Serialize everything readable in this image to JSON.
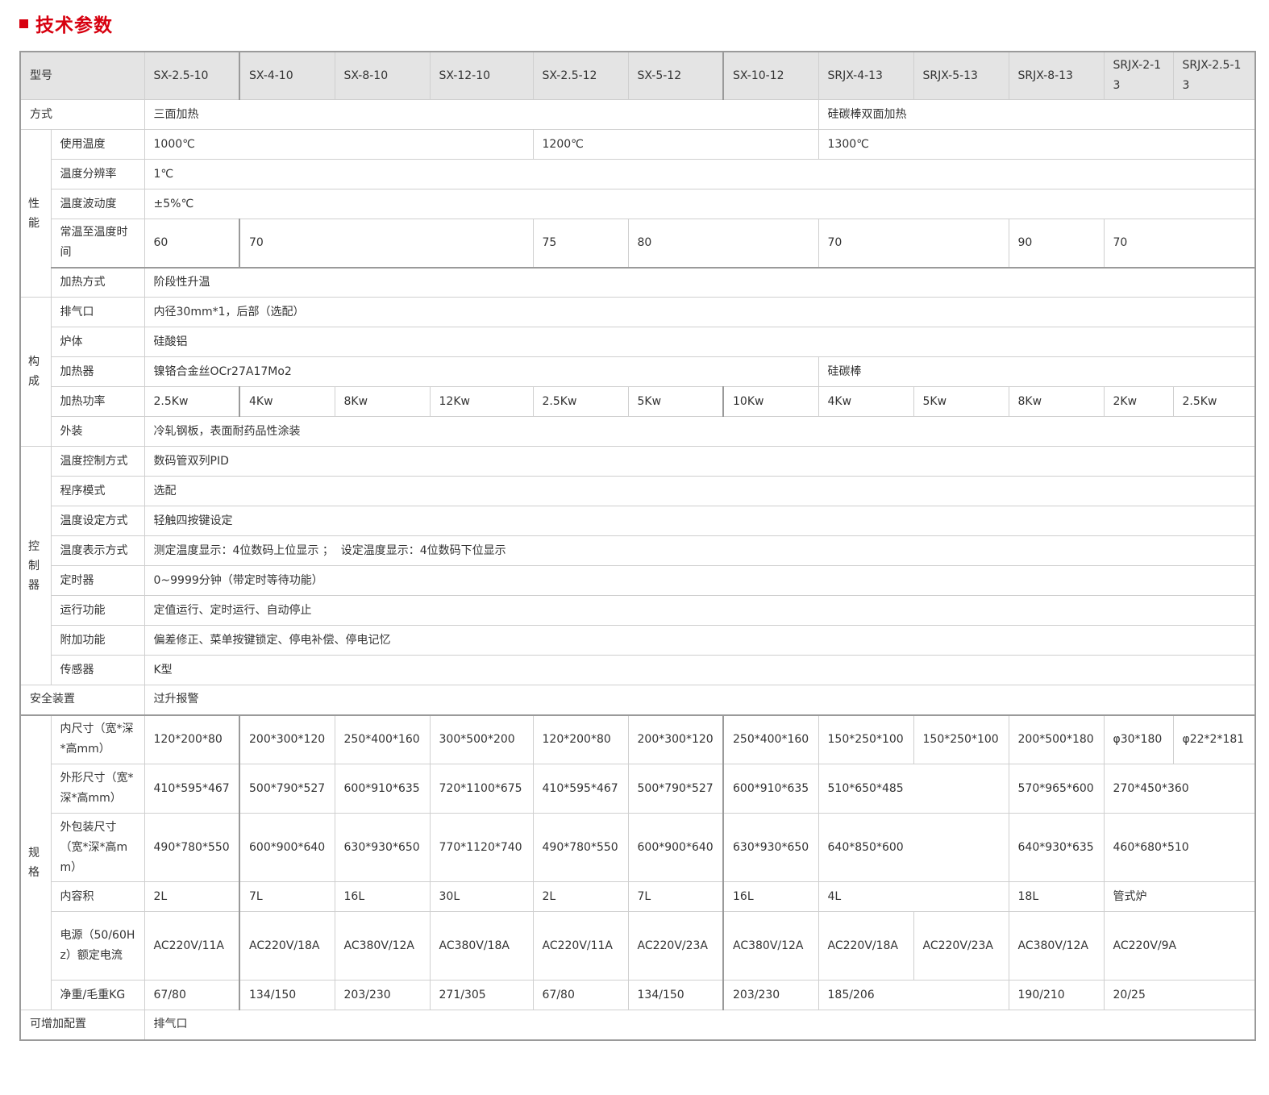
{
  "title": "技术参数",
  "header": {
    "label": "型号",
    "models": [
      "SX-2.5-10",
      "SX-4-10",
      "SX-8-10",
      "SX-12-10",
      "SX-2.5-12",
      "SX-5-12",
      "SX-10-12",
      "SRJX-4-13",
      "SRJX-5-13",
      "SRJX-8-13",
      "SRJX-2-13",
      "SRJX-2.5-13"
    ]
  },
  "groups": {
    "performance": "性能",
    "structure": "构成",
    "controller": "控制器",
    "spec": "规格"
  },
  "rows": {
    "method": {
      "label": "方式",
      "v1": "三面加热",
      "v2": "硅碳棒双面加热"
    },
    "use_temp": {
      "label": "使用温度",
      "v1": "1000℃",
      "v2": "1200℃",
      "v3": "1300℃"
    },
    "resolution": {
      "label": "温度分辨率",
      "v1": "1℃"
    },
    "fluctuation": {
      "label": "温度波动度",
      "v1": "±5%℃"
    },
    "heatup_time": {
      "label": "常温至温度时间",
      "values": [
        "60",
        "70",
        "75",
        "80",
        "70",
        "90",
        "70"
      ]
    },
    "heating_mode": {
      "label": "加热方式",
      "v1": "阶段性升温"
    },
    "exhaust": {
      "label": "排气口",
      "v1": "内径30mm*1，后部（选配）"
    },
    "body": {
      "label": "炉体",
      "v1": "硅酸铝"
    },
    "heater": {
      "label": "加热器",
      "v1": "镍铬合金丝OCr27A17Mo2",
      "v2": "硅碳棒"
    },
    "power": {
      "label": "加热功率",
      "values": [
        "2.5Kw",
        "4Kw",
        "8Kw",
        "12Kw",
        "2.5Kw",
        "5Kw",
        "10Kw",
        "4Kw",
        "5Kw",
        "8Kw",
        "2Kw",
        "2.5Kw"
      ]
    },
    "exterior": {
      "label": "外装",
      "v1": "冷轧钢板，表面耐药品性涂装"
    },
    "temp_control": {
      "label": "温度控制方式",
      "v1": "数码管双列PID"
    },
    "program_mode": {
      "label": "程序模式",
      "v1": "选配"
    },
    "temp_setting": {
      "label": "温度设定方式",
      "v1": "轻触四按键设定"
    },
    "temp_display": {
      "label": "温度表示方式",
      "v1": "测定温度显示：4位数码上位显示 ；  设定温度显示：4位数码下位显示"
    },
    "timer": {
      "label": "定时器",
      "v1": "0~9999分钟（带定时等待功能）"
    },
    "run_function": {
      "label": "运行功能",
      "v1": "定值运行、定时运行、自动停止"
    },
    "extra_function": {
      "label": "附加功能",
      "v1": "偏差修正、菜单按键锁定、停电补偿、停电记忆"
    },
    "sensor": {
      "label": "传感器",
      "v1": "K型"
    },
    "safety": {
      "label": "安全装置",
      "v1": "过升报警"
    },
    "inner_size": {
      "label": "内尺寸（宽*深*高mm）",
      "values": [
        "120*200*80",
        "200*300*120",
        "250*400*160",
        "300*500*200",
        "120*200*80",
        "200*300*120",
        "250*400*160",
        "150*250*100",
        "150*250*100",
        "200*500*180",
        "φ30*180",
        "φ22*2*181"
      ]
    },
    "outer_size": {
      "label": "外形尺寸（宽*深*高mm）",
      "values": [
        "410*595*467",
        "500*790*527",
        "600*910*635",
        "720*1100*675",
        "410*595*467",
        "500*790*527",
        "600*910*635",
        "510*650*485",
        "570*965*600",
        "270*450*360"
      ]
    },
    "package_size": {
      "label": "外包装尺寸（宽*深*高mm）",
      "values": [
        "490*780*550",
        "600*900*640",
        "630*930*650",
        "770*1120*740",
        "490*780*550",
        "600*900*640",
        "630*930*650",
        "640*850*600",
        "640*930*635",
        "460*680*510"
      ]
    },
    "volume": {
      "label": "内容积",
      "values": [
        "2L",
        "7L",
        "16L",
        "30L",
        "2L",
        "7L",
        "16L",
        "4L",
        "18L",
        "管式炉"
      ]
    },
    "power_supply": {
      "label": "电源（50/60Hz）额定电流",
      "values": [
        "AC220V/11A",
        "AC220V/18A",
        "AC380V/12A",
        "AC380V/18A",
        "AC220V/11A",
        "AC220V/23A",
        "AC380V/12A",
        "AC220V/18A",
        "AC220V/23A",
        "AC380V/12A",
        "AC220V/9A"
      ]
    },
    "weight": {
      "label": "净重/毛重KG",
      "values": [
        "67/80",
        "134/150",
        "203/230",
        "271/305",
        "67/80",
        "134/150",
        "203/230",
        "185/206",
        "190/210",
        "20/25"
      ]
    },
    "options": {
      "label": "可增加配置",
      "v1": "排气口"
    }
  }
}
